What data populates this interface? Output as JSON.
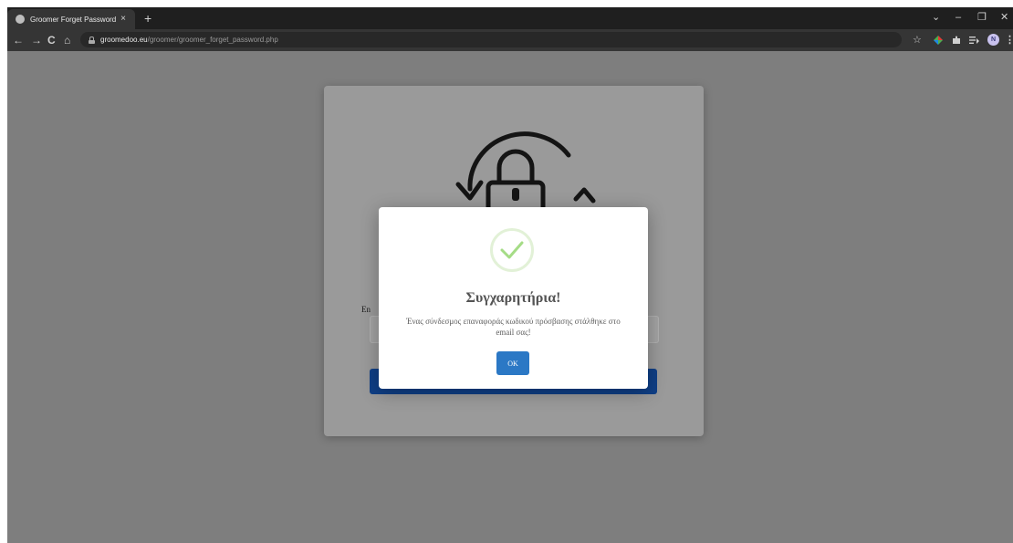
{
  "browser": {
    "tab_title": "Groomer Forget Password",
    "tab_close": "×",
    "new_tab": "+",
    "url_host": "groomedoo.eu",
    "url_path": "/groomer/groomer_forget_password.php",
    "profile_initial": "N",
    "window_controls": {
      "dropdown": "⌄",
      "minimize": "–",
      "restore": "❐",
      "close": "✕"
    },
    "nav": {
      "back": "←",
      "forward": "→",
      "reload": "C",
      "home": "⌂"
    },
    "toolbar_icons": [
      "star-icon",
      "color-extension-icon",
      "puzzle-icon",
      "reading-list-icon",
      "profile-avatar",
      "menu-dots-icon"
    ]
  },
  "page": {
    "email_label": "En"
  },
  "modal": {
    "title": "Συγχαρητήρια!",
    "message": "Ένας σύνδεσμος επαναφοράς κωδικού πρόσβασης στάλθηκε στο email σας!",
    "ok_label": "OK"
  },
  "colors": {
    "success": "#a5dc86",
    "ok_button": "#2b78c5",
    "submit_button": "#0f3f86"
  }
}
